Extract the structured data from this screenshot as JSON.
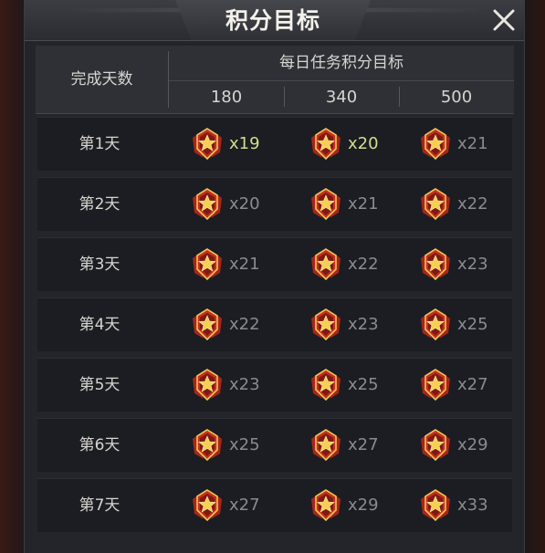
{
  "title": "积分目标",
  "header": {
    "days_label": "完成天数",
    "goal_label": "每日任务积分目标",
    "thresholds": [
      "180",
      "340",
      "500"
    ]
  },
  "rows": [
    {
      "day": "第1天",
      "rewards": [
        "x19",
        "x20",
        "x21"
      ],
      "achieved": [
        true,
        true,
        false
      ]
    },
    {
      "day": "第2天",
      "rewards": [
        "x20",
        "x21",
        "x22"
      ],
      "achieved": [
        false,
        false,
        false
      ]
    },
    {
      "day": "第3天",
      "rewards": [
        "x21",
        "x22",
        "x23"
      ],
      "achieved": [
        false,
        false,
        false
      ]
    },
    {
      "day": "第4天",
      "rewards": [
        "x22",
        "x23",
        "x25"
      ],
      "achieved": [
        false,
        false,
        false
      ]
    },
    {
      "day": "第5天",
      "rewards": [
        "x23",
        "x25",
        "x27"
      ],
      "achieved": [
        false,
        false,
        false
      ]
    },
    {
      "day": "第6天",
      "rewards": [
        "x25",
        "x27",
        "x29"
      ],
      "achieved": [
        false,
        false,
        false
      ]
    },
    {
      "day": "第7天",
      "rewards": [
        "x27",
        "x29",
        "x33"
      ],
      "achieved": [
        false,
        false,
        false
      ]
    }
  ],
  "icons": {
    "close": "close-icon",
    "reward": "medal-badge-icon"
  },
  "colors": {
    "achieved_text": "#cde08a",
    "pending_text": "#8a8b8e",
    "badge_gold": "#f1c24a",
    "badge_red": "#b3261b"
  }
}
